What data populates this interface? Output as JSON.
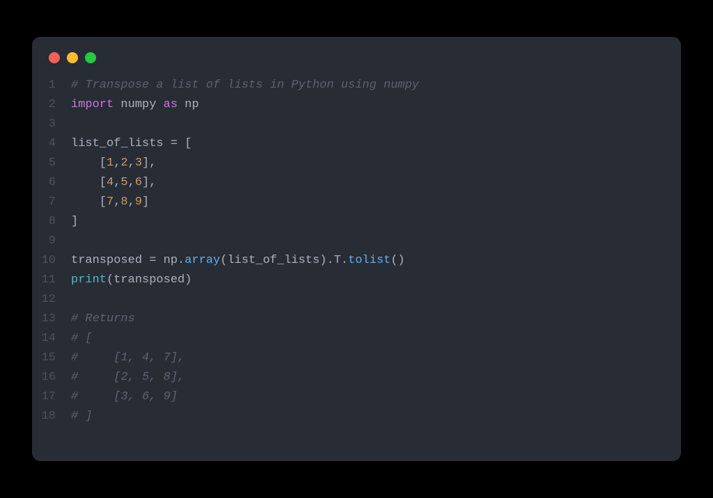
{
  "window": {
    "dots": [
      "red",
      "yellow",
      "green"
    ]
  },
  "code": {
    "lines": [
      {
        "n": "1",
        "tokens": [
          {
            "t": "# Transpose a list of lists in Python using numpy",
            "c": "comment"
          }
        ]
      },
      {
        "n": "2",
        "tokens": [
          {
            "t": "import",
            "c": "keyword"
          },
          {
            "t": " ",
            "c": "punct"
          },
          {
            "t": "numpy",
            "c": "module"
          },
          {
            "t": " ",
            "c": "punct"
          },
          {
            "t": "as",
            "c": "keyword"
          },
          {
            "t": " ",
            "c": "punct"
          },
          {
            "t": "np",
            "c": "module"
          }
        ]
      },
      {
        "n": "3",
        "tokens": []
      },
      {
        "n": "4",
        "tokens": [
          {
            "t": "list_of_lists ",
            "c": "ident"
          },
          {
            "t": "=",
            "c": "punct"
          },
          {
            "t": " [",
            "c": "punct"
          }
        ]
      },
      {
        "n": "5",
        "tokens": [
          {
            "t": "    [",
            "c": "punct"
          },
          {
            "t": "1",
            "c": "num"
          },
          {
            "t": ",",
            "c": "punct"
          },
          {
            "t": "2",
            "c": "num"
          },
          {
            "t": ",",
            "c": "punct"
          },
          {
            "t": "3",
            "c": "num"
          },
          {
            "t": "],",
            "c": "punct"
          }
        ]
      },
      {
        "n": "6",
        "tokens": [
          {
            "t": "    [",
            "c": "punct"
          },
          {
            "t": "4",
            "c": "num"
          },
          {
            "t": ",",
            "c": "punct"
          },
          {
            "t": "5",
            "c": "num"
          },
          {
            "t": ",",
            "c": "punct"
          },
          {
            "t": "6",
            "c": "num"
          },
          {
            "t": "],",
            "c": "punct"
          }
        ]
      },
      {
        "n": "7",
        "tokens": [
          {
            "t": "    [",
            "c": "punct"
          },
          {
            "t": "7",
            "c": "num"
          },
          {
            "t": ",",
            "c": "punct"
          },
          {
            "t": "8",
            "c": "num"
          },
          {
            "t": ",",
            "c": "punct"
          },
          {
            "t": "9",
            "c": "num"
          },
          {
            "t": "]",
            "c": "punct"
          }
        ]
      },
      {
        "n": "8",
        "tokens": [
          {
            "t": "]",
            "c": "punct"
          }
        ]
      },
      {
        "n": "9",
        "tokens": []
      },
      {
        "n": "10",
        "tokens": [
          {
            "t": "transposed ",
            "c": "ident"
          },
          {
            "t": "=",
            "c": "punct"
          },
          {
            "t": " np.",
            "c": "ident"
          },
          {
            "t": "array",
            "c": "func"
          },
          {
            "t": "(list_of_lists).T.",
            "c": "ident"
          },
          {
            "t": "tolist",
            "c": "func"
          },
          {
            "t": "()",
            "c": "punct"
          }
        ]
      },
      {
        "n": "11",
        "tokens": [
          {
            "t": "print",
            "c": "builtin"
          },
          {
            "t": "(transposed)",
            "c": "ident"
          }
        ]
      },
      {
        "n": "12",
        "tokens": []
      },
      {
        "n": "13",
        "tokens": [
          {
            "t": "# Returns",
            "c": "comment"
          }
        ]
      },
      {
        "n": "14",
        "tokens": [
          {
            "t": "# [",
            "c": "comment"
          }
        ]
      },
      {
        "n": "15",
        "tokens": [
          {
            "t": "#     [1, 4, 7],",
            "c": "comment"
          }
        ]
      },
      {
        "n": "16",
        "tokens": [
          {
            "t": "#     [2, 5, 8],",
            "c": "comment"
          }
        ]
      },
      {
        "n": "17",
        "tokens": [
          {
            "t": "#     [3, 6, 9]",
            "c": "comment"
          }
        ]
      },
      {
        "n": "18",
        "tokens": [
          {
            "t": "# ]",
            "c": "comment"
          }
        ]
      }
    ]
  }
}
